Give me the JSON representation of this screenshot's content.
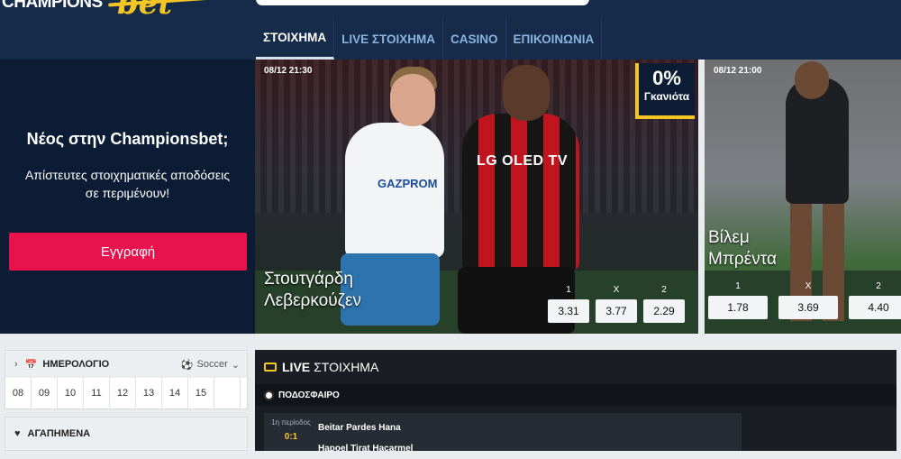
{
  "header": {
    "logo_main": "CHAMPIONS",
    "logo_accent": "bet",
    "nav": [
      {
        "label": "ΣΤΟΙΧΗΜΑ",
        "active": true
      },
      {
        "label": "LIVE ΣΤΟΙΧΗΜΑ",
        "active": false
      },
      {
        "label": "CASINO",
        "active": false
      },
      {
        "label": "ΕΠΙΚΟΙΝΩΝΙΑ",
        "active": false
      }
    ]
  },
  "promo": {
    "title": "Νέος στην Championsbet;",
    "subtitle_line1": "Απίστευτες στοιχηματικές αποδόσεις",
    "subtitle_line2": "σε περιμένουν!",
    "register_label": "Εγγραφή"
  },
  "featured": [
    {
      "date": "08/12 21:30",
      "badge_pct": "0%",
      "badge_text": "Γκανιότα",
      "home": "Στουτγάρδη",
      "away": "Λεβερκούζεν",
      "sponsor": "LG OLED TV",
      "sponsor2": "GAZPROM",
      "odds": [
        {
          "label": "1",
          "value": "3.31"
        },
        {
          "label": "X",
          "value": "3.77"
        },
        {
          "label": "2",
          "value": "2.29"
        }
      ]
    },
    {
      "date": "08/12 21:00",
      "home": "Βίλεμ",
      "away": "Μπρέντα",
      "odds": [
        {
          "label": "1",
          "value": "1.78"
        },
        {
          "label": "X",
          "value": "3.69"
        },
        {
          "label": "2",
          "value": "4.40"
        }
      ]
    }
  ],
  "calendar": {
    "title": "ΗΜΕΡΟΛΟΓΙΟ",
    "sport": "Soccer",
    "dates": [
      "08",
      "09",
      "10",
      "11",
      "12",
      "13",
      "14",
      "15",
      ""
    ]
  },
  "favorites": {
    "title": "ΑΓΑΠΗΜΕΝΑ"
  },
  "live": {
    "title_bold": "LIVE",
    "title_rest": "ΣΤΟΙΧΗΜΑ",
    "sport_tab": "ΠΟΔΟΣΦΑΙΡΟ",
    "event": {
      "period": "1η περίοδος",
      "score": "0:1",
      "home": "Beitar Pardes Hana",
      "away": "Hapoel Tirat Hacarmel"
    }
  },
  "colors": {
    "header_bg": "#162a4a",
    "accent_yellow": "#f4c623",
    "register_red": "#e8124c",
    "nav_link": "#8ab4de"
  }
}
